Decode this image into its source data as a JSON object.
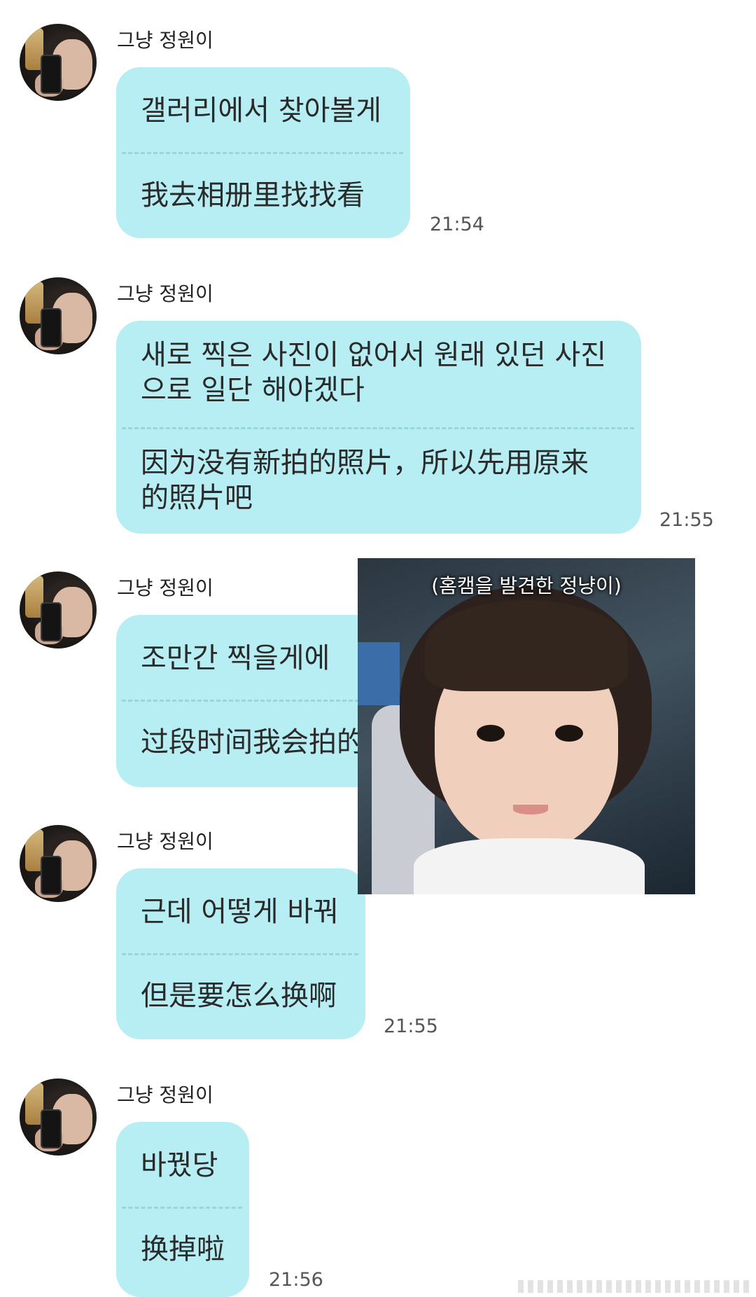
{
  "chat": {
    "messages": [
      {
        "sender": "그냥 정원이",
        "korean": "갤러리에서 찾아볼게",
        "chinese": "我去相册里找找看",
        "time": "21:54"
      },
      {
        "sender": "그냥 정원이",
        "korean": "새로 찍은 사진이 없어서 원래 있던 사진\n으로 일단 해야겠다",
        "chinese": "因为没有新拍的照片，所以先用原来\n的照片吧",
        "time": "21:55"
      },
      {
        "sender": "그냥 정원이",
        "korean": "조만간 찍을게에",
        "chinese": "过段时间我会拍的",
        "time": ""
      },
      {
        "sender": "그냥 정원이",
        "korean": "근데 어떻게 바꿔",
        "chinese": "但是要怎么换啊",
        "time": "21:55"
      },
      {
        "sender": "그냥 정원이",
        "korean": "바꿨당",
        "chinese": "换掉啦",
        "time": "21:56"
      }
    ],
    "sticker": {
      "caption": "(홈캠을 발견한 정냥이)"
    }
  }
}
